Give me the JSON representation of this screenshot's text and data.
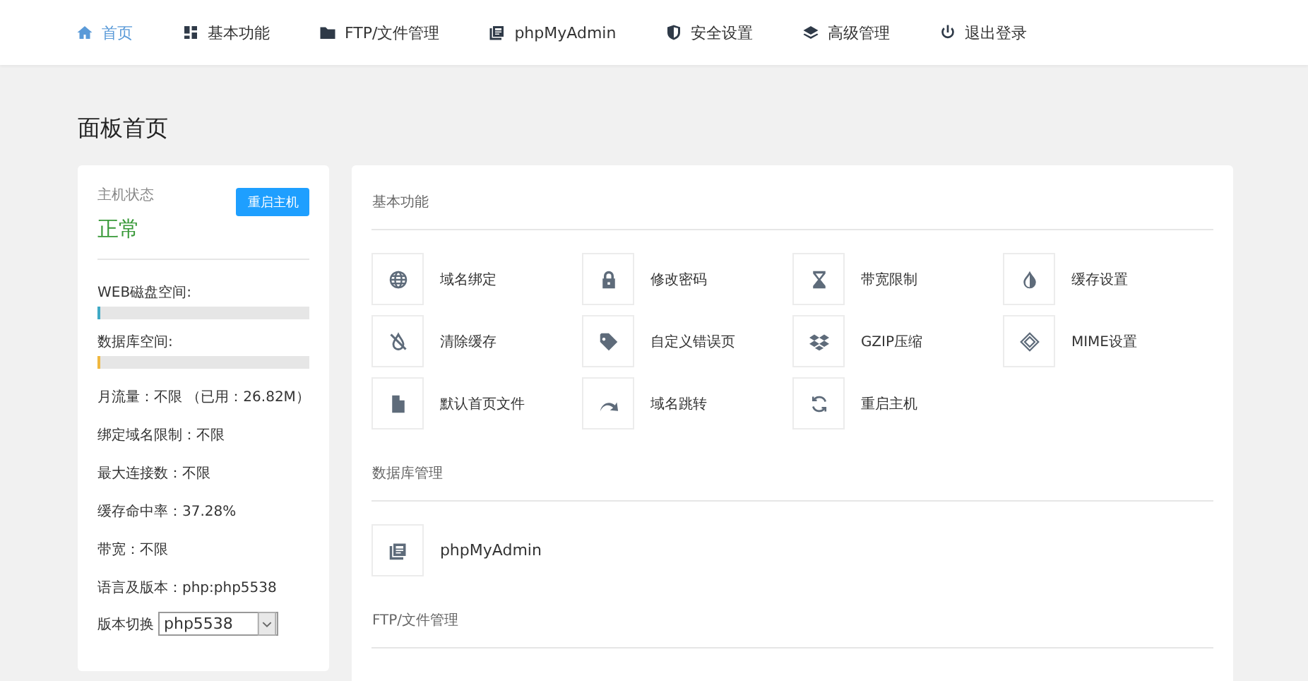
{
  "nav": [
    {
      "label": "首页",
      "selected": true
    },
    {
      "label": "基本功能",
      "selected": false
    },
    {
      "label": "FTP/文件管理",
      "selected": false
    },
    {
      "label": "phpMyAdmin",
      "selected": false
    },
    {
      "label": "安全设置",
      "selected": false
    },
    {
      "label": "高级管理",
      "selected": false
    },
    {
      "label": "退出登录",
      "selected": false
    }
  ],
  "page_title": "面板首页",
  "host": {
    "label": "主机状态",
    "status": "正常",
    "restart_button": "重启主机",
    "meters": [
      {
        "label": "WEB磁盘空间:",
        "level": 0.01,
        "color": "#3fa9c5"
      },
      {
        "label": "数据库空间:",
        "level": 0.01,
        "color": "#f0b840"
      }
    ],
    "stats": [
      "月流量：不限 （已用：26.82M）",
      "绑定域名限制：不限",
      "最大连接数：不限",
      "缓存命中率：37.28%",
      "带宽：不限",
      "语言及版本：php:php5538"
    ],
    "version_label": "版本切换",
    "version_value": "php5538"
  },
  "sections": [
    {
      "title": "基本功能",
      "items": [
        "域名绑定",
        "修改密码",
        "带宽限制",
        "缓存设置",
        "清除缓存",
        "自定义错误页",
        "GZIP压缩",
        "MIME设置",
        "默认首页文件",
        "域名跳转",
        "重启主机"
      ]
    },
    {
      "title": "数据库管理",
      "items": [
        "phpMyAdmin"
      ]
    },
    {
      "title": "FTP/文件管理"
    }
  ]
}
